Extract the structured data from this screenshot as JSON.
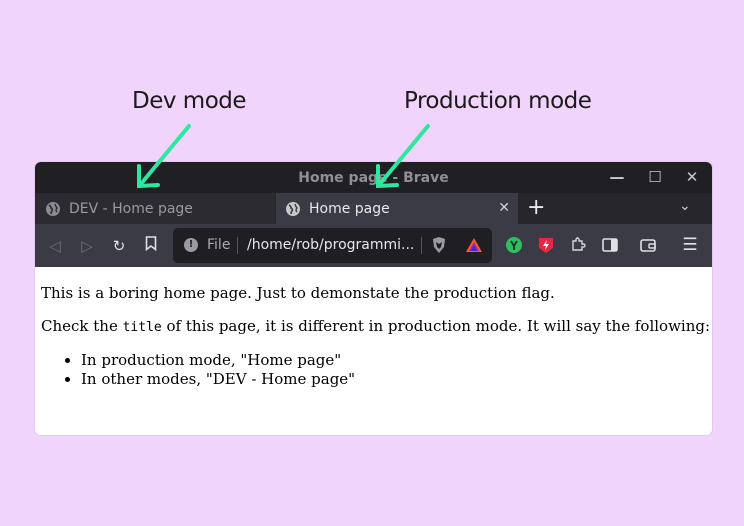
{
  "annotations": {
    "dev_label": "Dev mode",
    "prod_label": "Production mode"
  },
  "window": {
    "title": "Home page - Brave",
    "controls": [
      "minimize-icon",
      "maximize-icon",
      "close-icon"
    ]
  },
  "tabs": [
    {
      "label": "DEV - Home page",
      "active": false,
      "icon": "globe-icon"
    },
    {
      "label": "Home page",
      "active": true,
      "icon": "globe-icon"
    }
  ],
  "toolbar": {
    "scheme": "File",
    "url": "/home/rob/programmi...",
    "icons": [
      "back-icon",
      "forward-icon",
      "reload-icon",
      "bookmark-icon",
      "info-icon",
      "brave-shield-icon",
      "brave-rewards-icon",
      "vpn-icon",
      "red-extension-icon",
      "puzzle-icon",
      "sidebar-icon",
      "wallet-icon",
      "hamburger-menu-icon"
    ]
  },
  "content": {
    "p1": "This is a boring home page. Just to demonstate the production flag.",
    "p2_before": "Check the ",
    "p2_code": "title",
    "p2_after": " of this page, it is different in production mode. It will say the following:",
    "list": [
      "In production mode, \"Home page\"",
      "In other modes, \"DEV - Home page\""
    ]
  },
  "colors": {
    "background": "#f0d4fc",
    "arrow": "#2ee8a0",
    "titlebar": "#1f1f24",
    "tabstrip": "#26262c",
    "active_tab": "#3b3b45"
  }
}
